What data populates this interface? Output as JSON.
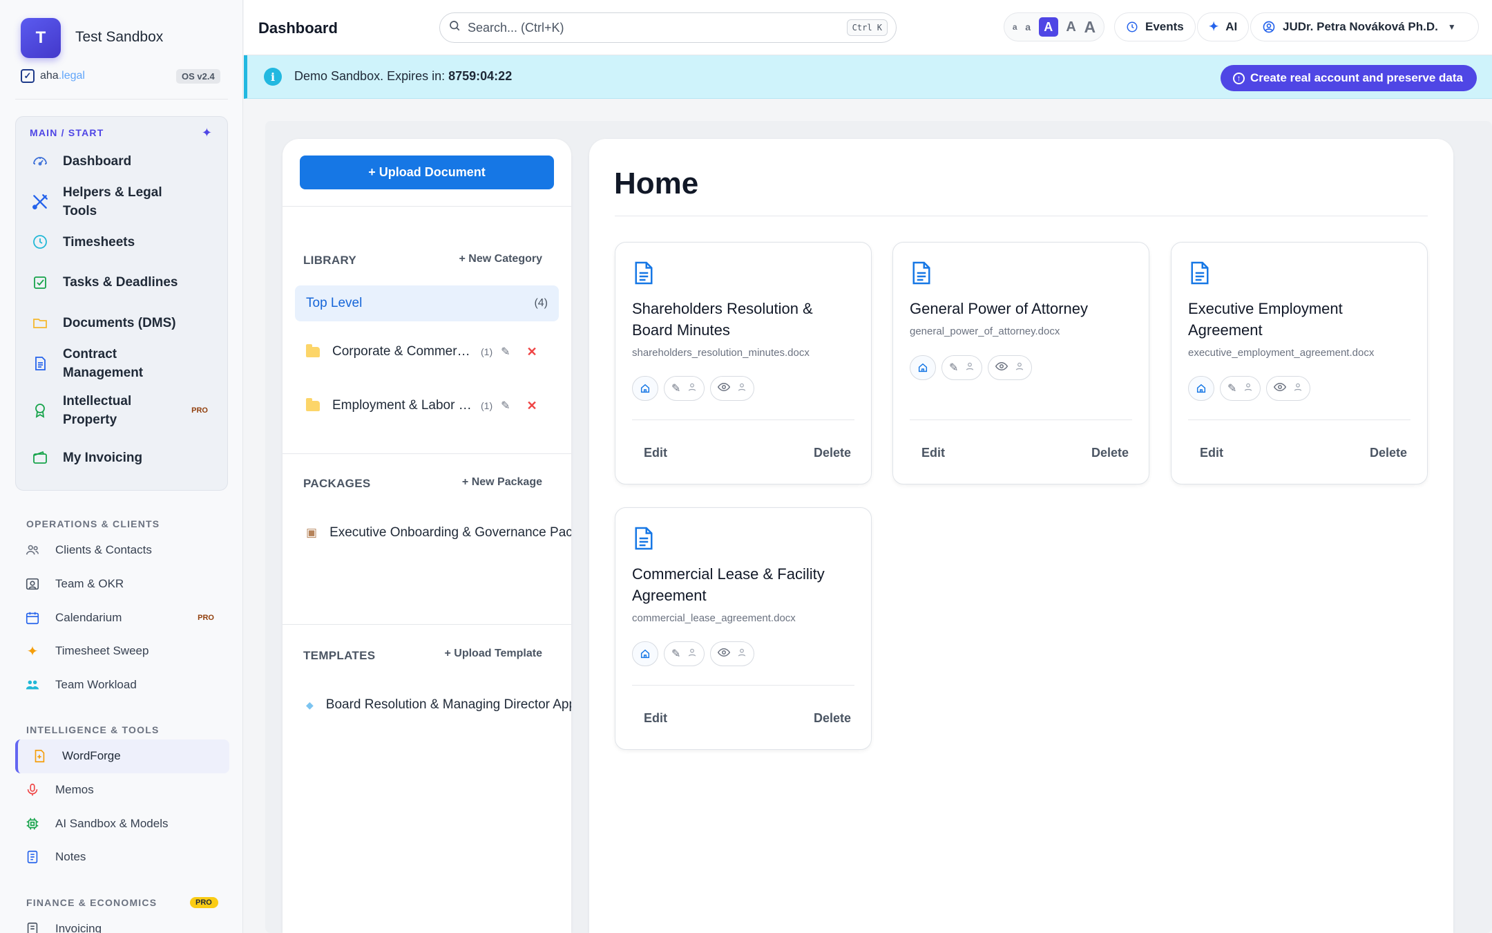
{
  "workspace": {
    "initial": "T",
    "name": "Test Sandbox",
    "brand_main": "aha",
    "brand_suffix": ".legal",
    "version": "OS v2.4"
  },
  "sidebar": {
    "main_section": "MAIN / START",
    "main_items": [
      {
        "label": "Dashboard",
        "icon": "gauge-icon"
      },
      {
        "label": "Helpers & Legal Tools",
        "icon": "tools-icon"
      },
      {
        "label": "Timesheets",
        "icon": "clock-icon"
      },
      {
        "label": "Tasks & Deadlines",
        "icon": "checkbox-icon"
      },
      {
        "label": "Documents (DMS)",
        "icon": "folder-icon"
      },
      {
        "label": "Contract Management",
        "icon": "contract-icon"
      },
      {
        "label": "Intellectual Property",
        "icon": "award-icon",
        "badge": "PRO"
      },
      {
        "label": "My Invoicing",
        "icon": "wallet-icon"
      }
    ],
    "ops_section": "OPERATIONS & CLIENTS",
    "ops_items": [
      {
        "label": "Clients & Contacts",
        "icon": "users-icon"
      },
      {
        "label": "Team & OKR",
        "icon": "id-card-icon"
      },
      {
        "label": "Calendarium",
        "icon": "calendar-icon",
        "badge": "PRO"
      },
      {
        "label": "Timesheet Sweep",
        "icon": "sparkle-icon"
      },
      {
        "label": "Team Workload",
        "icon": "team-icon"
      }
    ],
    "intel_section": "INTELLIGENCE & TOOLS",
    "intel_items": [
      {
        "label": "WordForge",
        "icon": "word-file-icon",
        "active": true
      },
      {
        "label": "Memos",
        "icon": "microphone-icon"
      },
      {
        "label": "AI Sandbox & Models",
        "icon": "chip-icon"
      },
      {
        "label": "Notes",
        "icon": "notes-icon"
      }
    ],
    "fin_section": "FINANCE & ECONOMICS",
    "fin_badge": "PRO",
    "fin_items": [
      {
        "label": "Invoicing",
        "icon": "invoice-icon"
      }
    ]
  },
  "topbar": {
    "title": "Dashboard",
    "search_placeholder": "Search... (Ctrl+K)",
    "shortcut": "Ctrl K",
    "font_sizes": [
      "a",
      "a",
      "A",
      "A",
      "A"
    ],
    "events_label": "Events",
    "ai_label": "AI",
    "user_name": "JUDr. Petra Nováková Ph.D."
  },
  "banner": {
    "text": "Demo Sandbox. Expires in: ",
    "time": "8759:04:22",
    "cta_label": "Create real account and preserve data"
  },
  "library": {
    "upload_label": "+ Upload Document",
    "library_heading": "LIBRARY",
    "new_category": "+ New Category",
    "top_level": {
      "label": "Top Level",
      "count": "(4)"
    },
    "categories": [
      {
        "name": "Corporate & Commercial Law",
        "count": "(1)"
      },
      {
        "name": "Employment & Labor Law",
        "count": "(1)"
      }
    ],
    "packages_heading": "PACKAGES",
    "new_package": "+ New Package",
    "packages": [
      {
        "name": "Executive Onboarding & Governance Package"
      }
    ],
    "templates_heading": "TEMPLATES",
    "upload_template": "+ Upload Template",
    "templates": [
      {
        "name": "Board Resolution & Managing Director Appointment"
      }
    ]
  },
  "home": {
    "title": "Home",
    "edit_label": "Edit",
    "delete_label": "Delete",
    "documents": [
      {
        "title": "Shareholders Resolution & Board Minutes",
        "file": "shareholders_resolution_minutes.docx"
      },
      {
        "title": "General Power of Attorney",
        "file": "general_power_of_attorney.docx"
      },
      {
        "title": "Executive Employment Agreement",
        "file": "executive_employment_agreement.docx"
      },
      {
        "title": "Commercial Lease & Facility Agreement",
        "file": "commercial_lease_agreement.docx"
      }
    ]
  },
  "colors": {
    "accent": "#4f46e5",
    "primary_button": "#1677e5",
    "banner_bg": "#cff3fb",
    "pro_badge": "#facc15"
  }
}
